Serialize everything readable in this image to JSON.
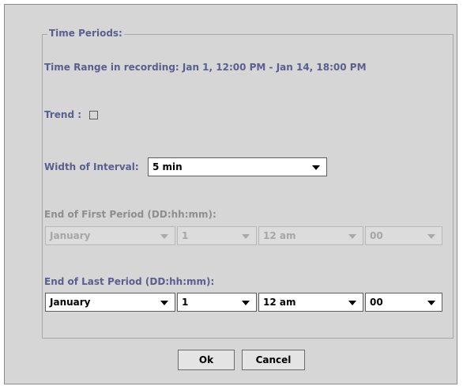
{
  "time_periods": {
    "group_title": "Time Periods:",
    "range_text": "Time Range in recording: Jan 1, 12:00 PM - Jan 14, 18:00 PM",
    "trend_label": "Trend :",
    "trend_checked": false,
    "width_label": "Width of Interval:",
    "width_value": "5 min",
    "first_period": {
      "label": "End of First Period (DD:hh:mm):",
      "enabled": false,
      "month": "January",
      "day": "1",
      "hour": "12 am",
      "minute": "00"
    },
    "last_period": {
      "label": "End of Last Period (DD:hh:mm):",
      "enabled": true,
      "month": "January",
      "day": "1",
      "hour": "12 am",
      "minute": "00"
    }
  },
  "buttons": {
    "ok": "Ok",
    "cancel": "Cancel"
  },
  "icons": {
    "dropdown": "chevron-down-icon"
  }
}
